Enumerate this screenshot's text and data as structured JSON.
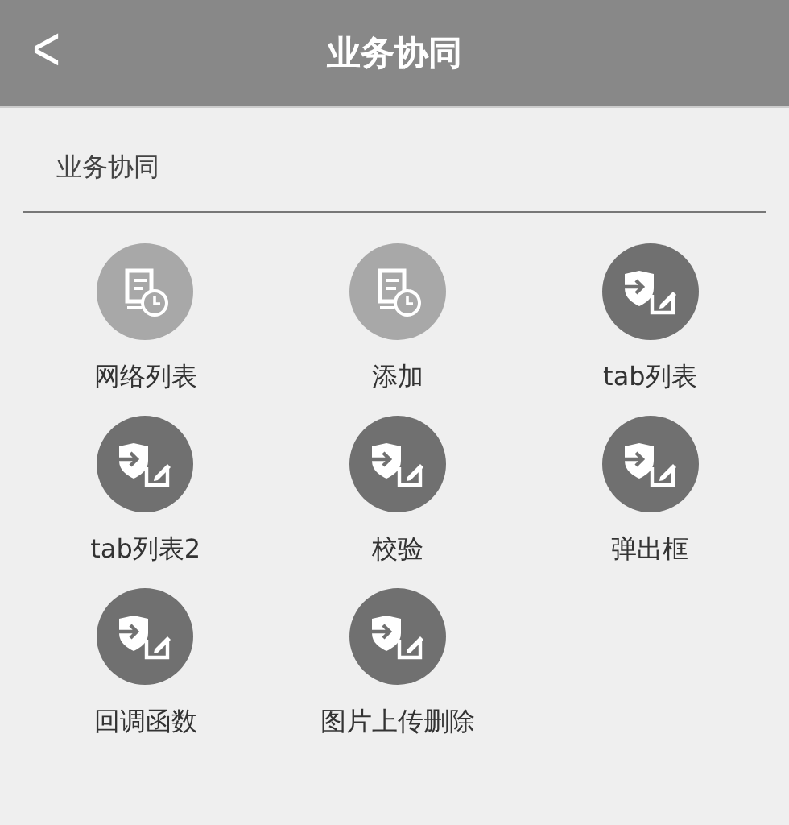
{
  "header": {
    "back": "<",
    "title": "业务协同"
  },
  "section": {
    "title": "业务协同"
  },
  "items": [
    {
      "label": "网络列表",
      "kind": "document"
    },
    {
      "label": "添加",
      "kind": "document"
    },
    {
      "label": "tab列表",
      "kind": "shield"
    },
    {
      "label": "tab列表2",
      "kind": "shield"
    },
    {
      "label": "校验",
      "kind": "shield"
    },
    {
      "label": "弹出框",
      "kind": "shield"
    },
    {
      "label": "回调函数",
      "kind": "shield"
    },
    {
      "label": "图片上传删除",
      "kind": "shield"
    }
  ]
}
